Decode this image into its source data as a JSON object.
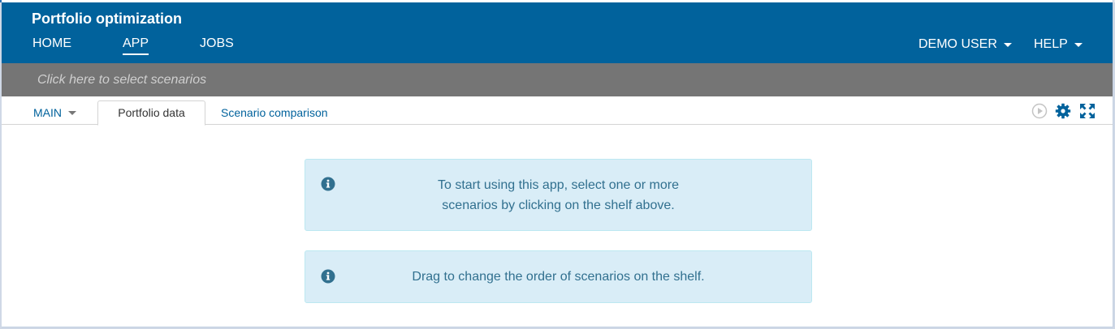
{
  "header": {
    "title": "Portfolio optimization",
    "nav": {
      "home": "HOME",
      "app": "APP",
      "jobs": "JOBS"
    },
    "user_menu": "DEMO USER",
    "help_menu": "HELP"
  },
  "shelf": {
    "placeholder": "Click here to select scenarios"
  },
  "tabs": {
    "main_label": "MAIN",
    "items": [
      {
        "label": "Portfolio data",
        "active": true
      },
      {
        "label": "Scenario comparison",
        "active": false
      }
    ]
  },
  "toolbar": {
    "icons": [
      "play-icon",
      "gear-icon",
      "expand-icon"
    ]
  },
  "messages": {
    "start_line1": "To start using this app, select one or more",
    "start_line2": "scenarios by clicking on the shelf above.",
    "drag": "Drag to change the order of scenarios on the shelf."
  },
  "colors": {
    "header_bg": "#01629c",
    "shelf_bg": "#757575",
    "alert_bg": "#d9edf7",
    "alert_text": "#31708f",
    "link": "#01629c"
  }
}
